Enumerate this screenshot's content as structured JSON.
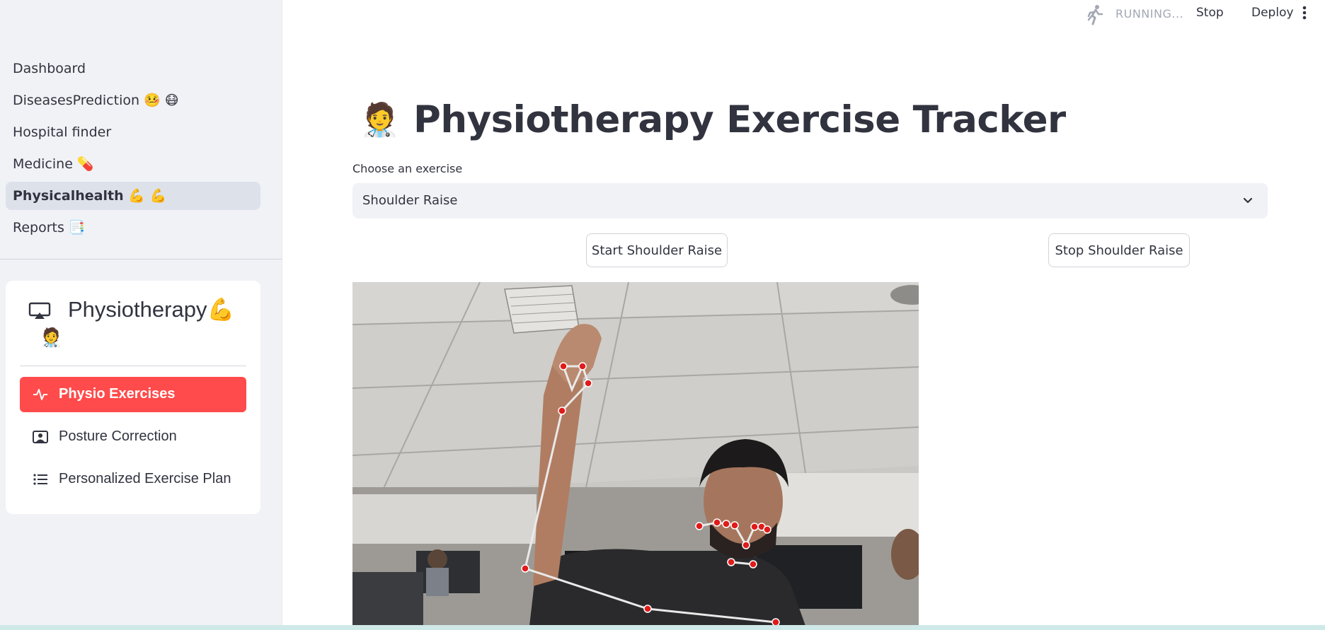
{
  "sidebar": {
    "nav": [
      {
        "label": "Dashboard"
      },
      {
        "label": "DiseasesPrediction 🤒 😷"
      },
      {
        "label": "Hospital finder"
      },
      {
        "label": "Medicine 💊"
      },
      {
        "label": "Physicalhealth 💪 💪",
        "active": true
      },
      {
        "label": "Reports 📑"
      }
    ],
    "menu": {
      "title": "Physiotherapy💪",
      "title_emoji": "🧑‍⚕️",
      "title_icon": "cast-icon",
      "items": [
        {
          "label": "Physio Exercises",
          "icon": "activity-icon",
          "selected": true
        },
        {
          "label": "Posture Correction",
          "icon": "person-badge-icon",
          "selected": false
        },
        {
          "label": "Personalized Exercise Plan",
          "icon": "list-icon",
          "selected": false
        }
      ]
    }
  },
  "toolbar": {
    "status": "RUNNING...",
    "stop_label": "Stop",
    "deploy_label": "Deploy"
  },
  "main": {
    "title_emoji": "🧑‍⚕️",
    "title": "Physiotherapy Exercise Tracker",
    "select_label": "Choose an exercise",
    "select_value": "Shoulder Raise",
    "start_button": "Start Shoulder Raise",
    "stop_button": "Stop Shoulder Raise"
  },
  "colors": {
    "accent": "#ff4b4b",
    "sidebar_bg": "#f0f2f6",
    "text": "#31333f",
    "landmark": "#e01b1b"
  }
}
